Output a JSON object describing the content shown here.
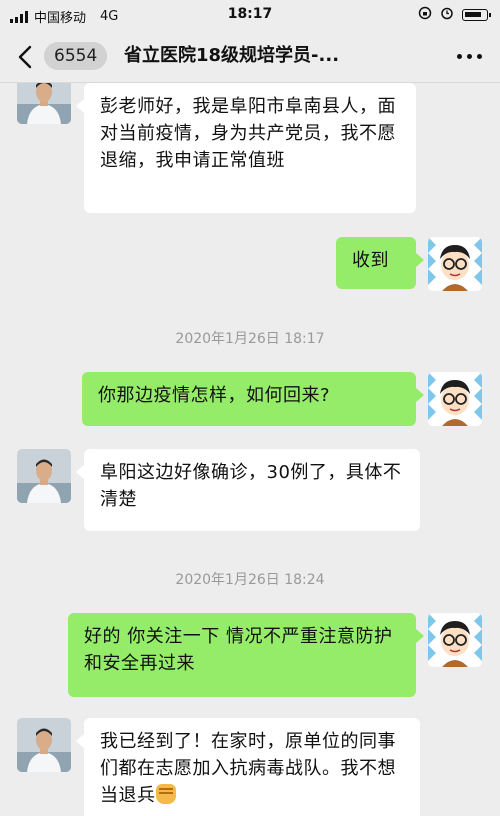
{
  "status_bar": {
    "carrier": "中国移动",
    "network": "4G",
    "time": "18:17"
  },
  "nav": {
    "badge_count": "6554",
    "title": "省立医院18级规培学员-..."
  },
  "messages": [
    {
      "side": "left",
      "text": "彭老师好，我是阜阳市阜南县人，面对当前疫情，身为共产党员，我不愿退缩，我申请正常值班"
    },
    {
      "side": "right",
      "text": "收到"
    },
    {
      "type": "timestamp",
      "text": "2020年1月26日 18:17"
    },
    {
      "side": "right",
      "text": "你那边疫情怎样，如何回来?"
    },
    {
      "side": "left",
      "text": "阜阳这边好像确诊，30例了，具体不清楚"
    },
    {
      "type": "timestamp",
      "text": "2020年1月26日 18:24"
    },
    {
      "side": "right",
      "text": "好的 你关注一下 情况不严重注意防护和安全再过来"
    },
    {
      "side": "left",
      "text": "我已经到了！在家时，原单位的同事们都在志愿加入抗病毒战队。我不想当退兵",
      "emoji": "fist-emoji"
    }
  ],
  "colors": {
    "background": "#ededed",
    "outgoing_bubble": "#95ec69",
    "incoming_bubble": "#ffffff",
    "timestamp": "#999999"
  }
}
